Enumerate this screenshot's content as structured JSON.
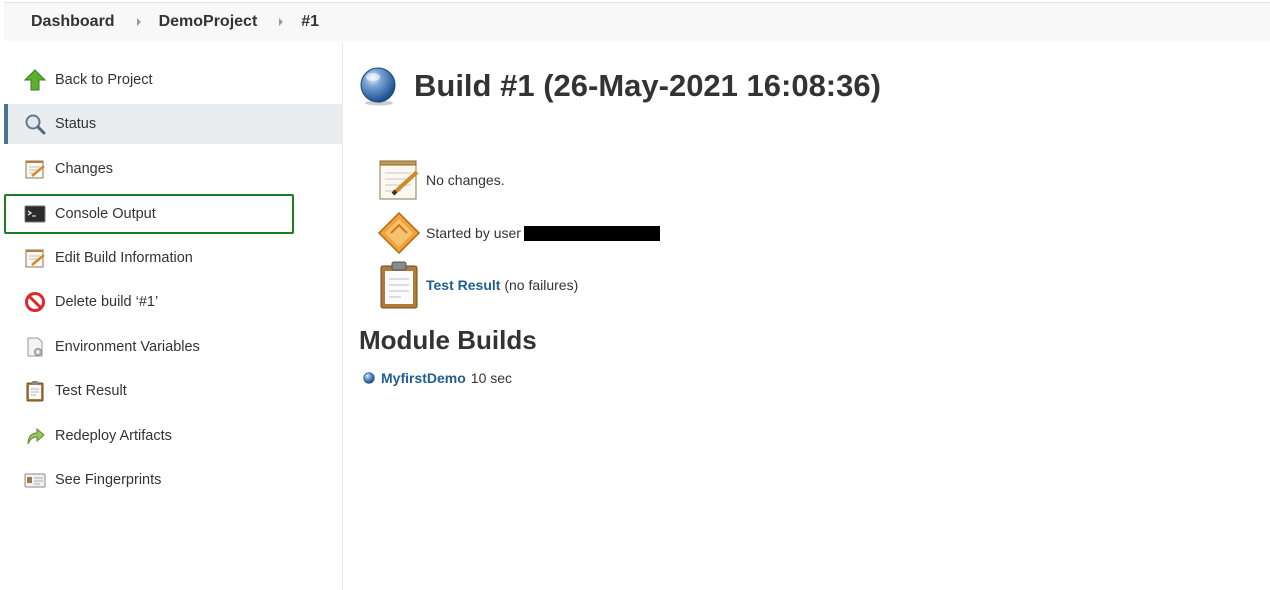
{
  "breadcrumb": [
    "Dashboard",
    "DemoProject",
    "#1"
  ],
  "sidebar": {
    "items": [
      {
        "label": "Back to Project",
        "icon": "up-arrow-icon"
      },
      {
        "label": "Status",
        "icon": "magnifier-icon",
        "active": true
      },
      {
        "label": "Changes",
        "icon": "notepad-icon"
      },
      {
        "label": "Console Output",
        "icon": "terminal-icon",
        "highlighted": true
      },
      {
        "label": "Edit Build Information",
        "icon": "notepad-icon"
      },
      {
        "label": "Delete build ‘#1’",
        "icon": "no-entry-icon"
      },
      {
        "label": "Environment Variables",
        "icon": "document-gear-icon"
      },
      {
        "label": "Test Result",
        "icon": "clipboard-icon"
      },
      {
        "label": "Redeploy Artifacts",
        "icon": "redeploy-arrow-icon"
      },
      {
        "label": "See Fingerprints",
        "icon": "id-card-icon"
      }
    ]
  },
  "main": {
    "title": "Build #1 (26-May-2021 16:08:36)",
    "status_icon": "blue-ball-icon",
    "changes_text": "No changes.",
    "started_by": "Started by user",
    "test_result_link": "Test Result",
    "test_result_suffix": "(no failures)",
    "module_heading": "Module Builds",
    "modules": [
      {
        "name": "MyfirstDemo",
        "duration": "10 sec"
      }
    ]
  },
  "colors": {
    "link": "#1f5e94",
    "active_border": "#4b758b",
    "highlight_outline": "#1d7a24"
  }
}
